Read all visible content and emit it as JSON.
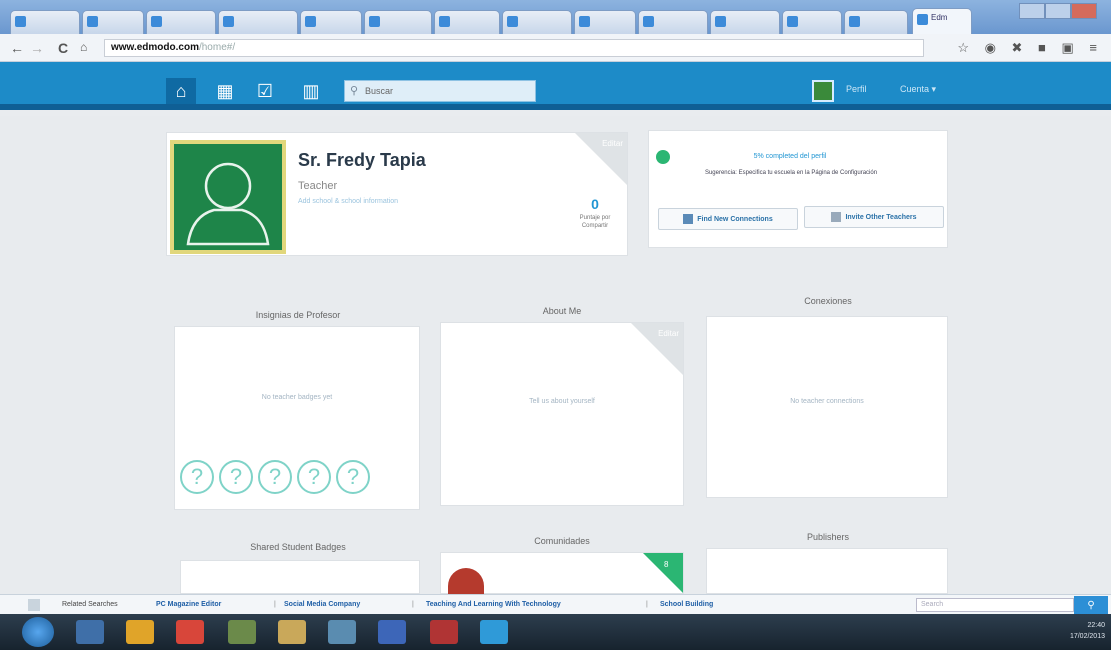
{
  "browser": {
    "tabs": [
      "",
      "",
      "",
      "",
      "",
      "",
      "",
      "",
      "",
      "",
      "",
      "",
      "",
      "",
      "",
      "Edm"
    ],
    "url_domain": "www.edmodo.com",
    "url_path": "/home#/"
  },
  "header": {
    "search_placeholder": "Buscar",
    "perfil_label": "Perfil",
    "cuenta_label": "Cuenta ▾"
  },
  "profile": {
    "name": "Sr. Fredy Tapia",
    "role": "Teacher",
    "add_info": "Add school & school information",
    "count": "0",
    "count_label": "Puntaje por Compartir",
    "edit_label": "Editar"
  },
  "progress": {
    "text": "5% completed del perfil",
    "suggestion": "Sugerencia: Especifica tu escuela en la Página de Configuración",
    "find_btn": "Find New Connections",
    "invite_btn": "Invite Other Teachers"
  },
  "sections": {
    "badges_title": "Insignias de Profesor",
    "badges_empty": "No teacher badges yet",
    "about_title": "About Me",
    "about_empty": "Tell us about yourself",
    "about_edit": "Editar",
    "connections_title": "Conexiones",
    "connections_empty": "No teacher connections",
    "shared_title": "Shared Student Badges",
    "communities_title": "Comunidades",
    "communities_count": "8",
    "publishers_title": "Publishers"
  },
  "badge_marks": [
    "?",
    "?",
    "?",
    "?",
    "?"
  ],
  "related": {
    "label": "Related Searches",
    "items": [
      "PC Magazine Editor",
      "Social Media Company",
      "Teaching And Learning With Technology",
      "School Building"
    ],
    "search_placeholder": "Search"
  },
  "taskbar": {
    "time": "22:40",
    "date": "17/02/2013"
  },
  "colors": {
    "edmodo_blue": "#1d8bc8",
    "accent_green": "#2bb673",
    "avatar_green": "#1e8549"
  }
}
